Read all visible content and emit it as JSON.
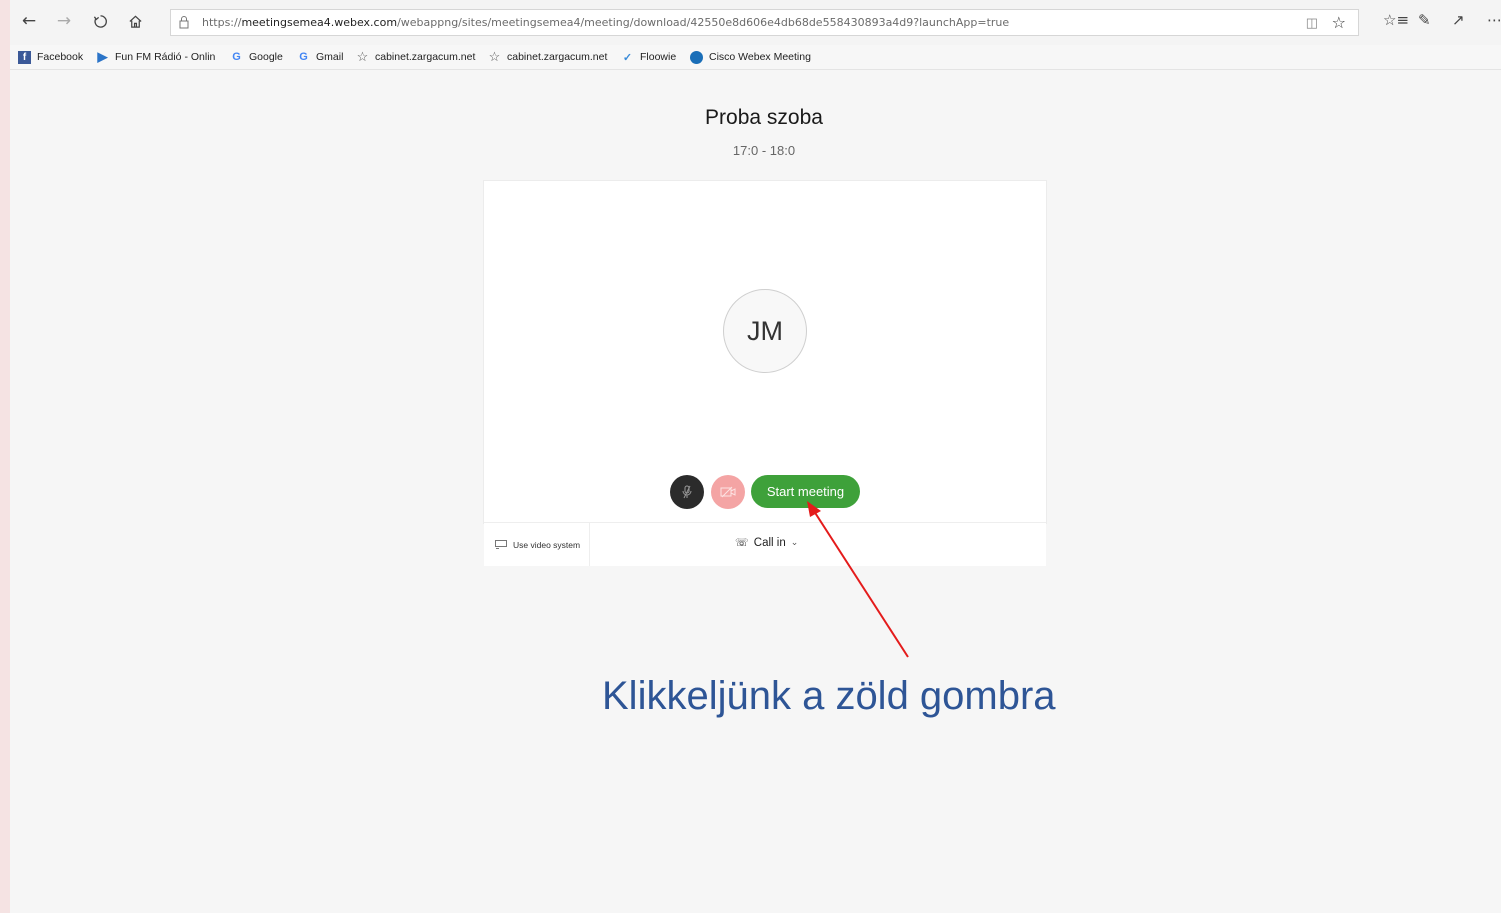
{
  "browser": {
    "url_prefix": "https://",
    "url_host": "meetingsemea4.webex.com",
    "url_path": "/webappng/sites/meetingsemea4/meeting/download/42550e8d606e4db68de558430893a4d9?launchApp=true",
    "nav": {
      "back_icon": "arrow-left-icon",
      "forward_icon": "arrow-right-icon",
      "refresh_icon": "refresh-icon",
      "home_icon": "home-icon"
    },
    "favorites": [
      {
        "label": "Facebook",
        "icon": "facebook-icon",
        "color": "#3b5998"
      },
      {
        "label": "Fun FM Rádió - Onlin",
        "icon": "play-circle-icon",
        "color": "#2b74c8"
      },
      {
        "label": "Google",
        "icon": "google-icon",
        "color": "#4285f4"
      },
      {
        "label": "Gmail",
        "icon": "google-icon",
        "color": "#4285f4"
      },
      {
        "label": "cabinet.zargacum.net",
        "icon": "star-icon",
        "color": "#555555"
      },
      {
        "label": "cabinet.zargacum.net",
        "icon": "star-icon",
        "color": "#555555"
      },
      {
        "label": "Floowie",
        "icon": "floowie-icon",
        "color": "#3a8bd8"
      },
      {
        "label": "Cisco Webex Meeting",
        "icon": "webex-icon",
        "color": "#1a6eb8"
      }
    ]
  },
  "meeting": {
    "title": "Proba szoba",
    "time": "17:0 - 18:0",
    "avatar_initials": "JM",
    "start_label": "Start meeting",
    "video_system_label": "Use video system",
    "call_in_label": "Call in",
    "accent_green": "#3ea13a"
  },
  "annotation": {
    "text": "Klikkeljünk a zöld gombra",
    "arrow_color": "#e41b1b"
  }
}
